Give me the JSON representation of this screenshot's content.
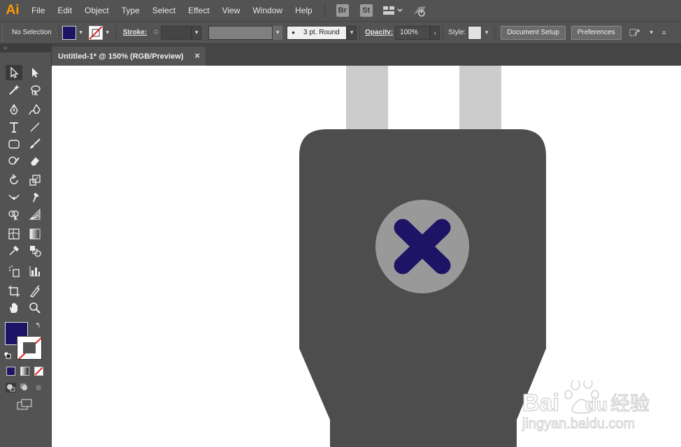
{
  "app": {
    "logo": "Ai",
    "accent": "#ff9a00"
  },
  "menubar": {
    "items": [
      "File",
      "Edit",
      "Object",
      "Type",
      "Select",
      "Effect",
      "View",
      "Window",
      "Help"
    ],
    "bridge_badge": "Br",
    "stock_badge": "St"
  },
  "controlbar": {
    "selection_label": "No Selection",
    "fill_color": "#1e1466",
    "stroke_label": "Stroke:",
    "brush_value": "3 pt. Round",
    "opacity_label": "Opacity:",
    "opacity_value": "100%",
    "style_label": "Style:",
    "document_setup_label": "Document Setup",
    "preferences_label": "Preferences"
  },
  "tools_panel": {
    "collapse_glyph": "‹‹",
    "fill_color": "#1e1466"
  },
  "document": {
    "tab_title": "Untitled-1* @ 150% (RGB/Preview)",
    "close_glyph": "×"
  },
  "artwork": {
    "plug_body_color": "#4d4d4d",
    "prong_color": "#cccccc",
    "circle_color": "#999999",
    "x_mark_color": "#1e1466"
  },
  "watermark": {
    "brand": "Bai",
    "brand_suffix": "du",
    "chinese": "经验",
    "url": "jingyan.baidu.com"
  }
}
